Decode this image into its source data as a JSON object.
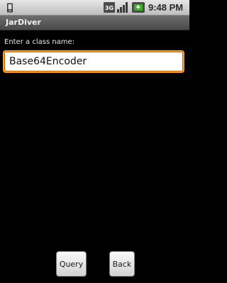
{
  "status_bar": {
    "network_label": "3G",
    "time": "9:48 PM",
    "icons": [
      "notification-icon",
      "3g-icon",
      "signal-icon",
      "battery-charging-icon"
    ]
  },
  "app": {
    "title": "JarDiver"
  },
  "form": {
    "label": "Enter a class name:",
    "input_value": "Base64Encoder",
    "input_placeholder": ""
  },
  "buttons": {
    "query_label": "Query",
    "back_label": "Back"
  },
  "colors": {
    "background": "#000000",
    "input_focus_border": "#ff9a1a",
    "battery_accent": "#3fae2a"
  }
}
